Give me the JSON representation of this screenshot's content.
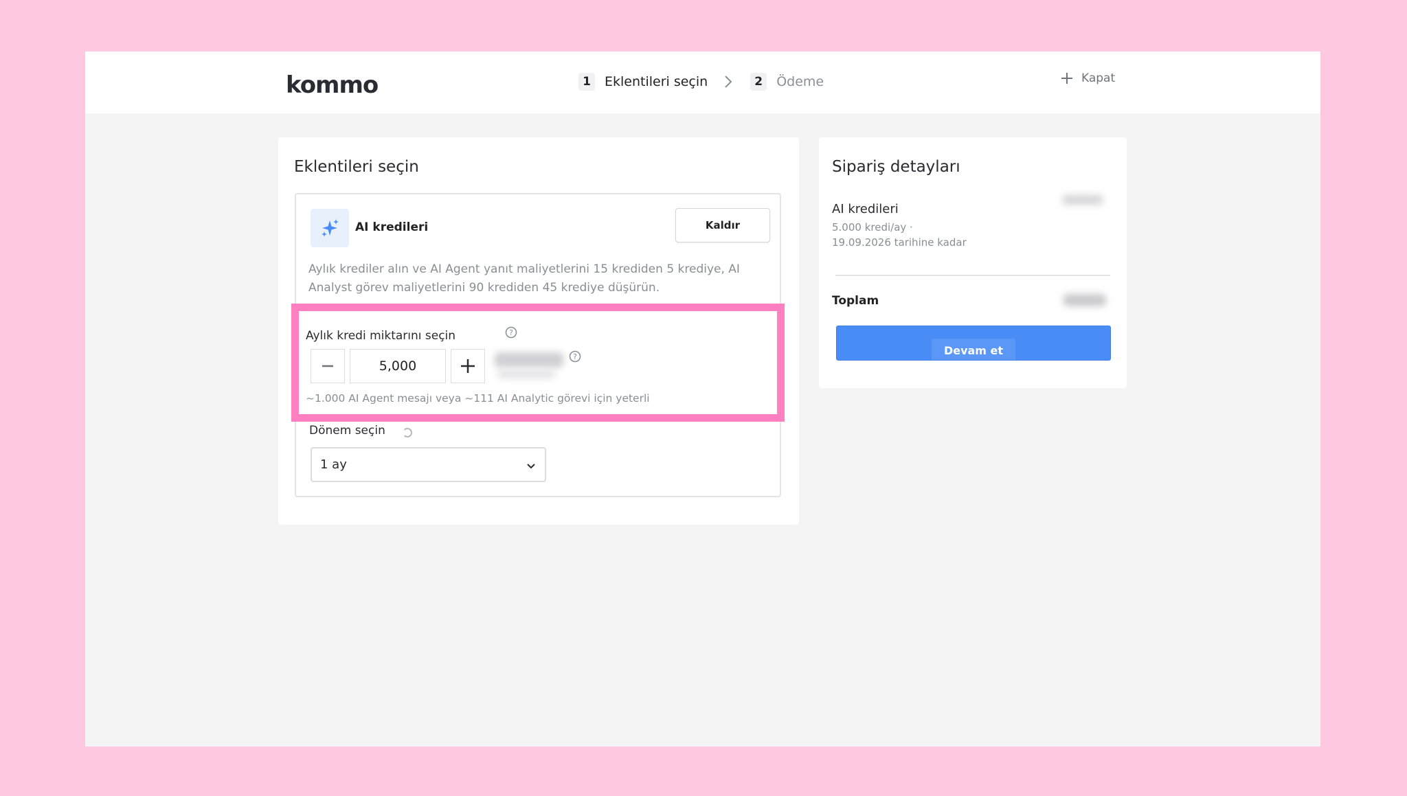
{
  "header": {
    "logo_text": "Kommo",
    "steps": [
      {
        "num": "1",
        "label": "Eklentileri seçin"
      },
      {
        "num": "2",
        "label": "Ödeme"
      }
    ],
    "close_label": "Kapat"
  },
  "addons": {
    "title": "Eklentileri seçin",
    "item": {
      "name": "AI kredileri",
      "icon": "sparkles-icon",
      "remove_label": "Kaldır",
      "description": "Aylık krediler alın ve AI Agent yanıt maliyetlerini 15 krediden 5 krediye, AI Analyst görev maliyetlerini 90 krediden 45 krediye düşürün."
    },
    "credit": {
      "label": "Aylık kredi miktarını seçin",
      "value": "5,000",
      "hint": "~1.000 AI Agent mesajı veya ~111 AI Analytic görevi için yeterli"
    },
    "period": {
      "label": "Dönem seçin",
      "selected": "1 ay"
    }
  },
  "order": {
    "title": "Sipariş detayları",
    "item_name": "AI kredileri",
    "item_sub_1": "5.000 kredi/ay ·",
    "item_sub_2": "19.09.2026 tarihine kadar",
    "total_label": "Toplam",
    "continue_label": "Devam et"
  },
  "colors": {
    "background": "#fec8e0",
    "highlight": "#ff80c0",
    "primary_button": "#4a8cf5"
  }
}
